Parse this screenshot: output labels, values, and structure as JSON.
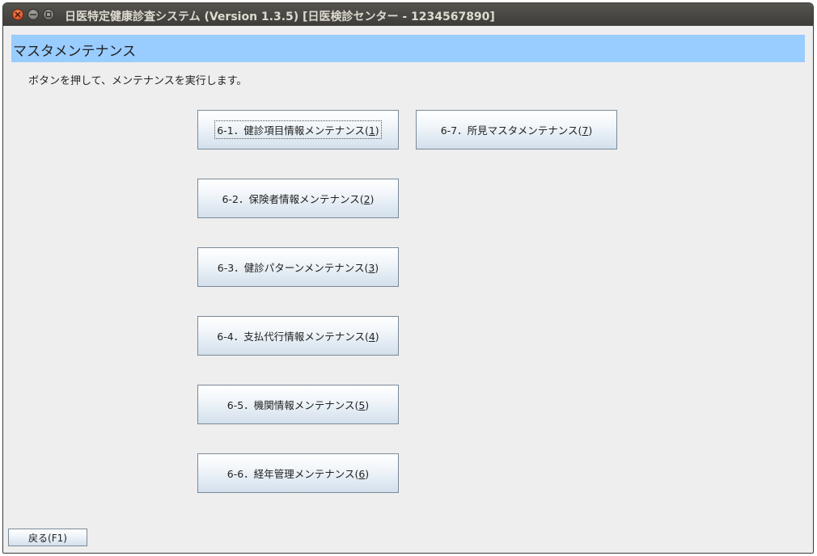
{
  "window": {
    "title": "日医特定健康診査システム (Version 1.3.5) [日医検診センター - 1234567890]"
  },
  "header": {
    "title": "マスタメンテナンス"
  },
  "instruction": "ボタンを押して、メンテナンスを実行します。",
  "buttons": [
    {
      "prefix": "6-1．健診項目情報メンテナンス(",
      "key": "1",
      "suffix": ")"
    },
    {
      "prefix": "6-2．保険者情報メンテナンス(",
      "key": "2",
      "suffix": ")"
    },
    {
      "prefix": "6-3．健診パターンメンテナンス(",
      "key": "3",
      "suffix": ")"
    },
    {
      "prefix": "6-4．支払代行情報メンテナンス(",
      "key": "4",
      "suffix": ")"
    },
    {
      "prefix": "6-5．機関情報メンテナンス(",
      "key": "5",
      "suffix": ")"
    },
    {
      "prefix": "6-6．経年管理メンテナンス(",
      "key": "6",
      "suffix": ")"
    },
    {
      "prefix": "6-7．所見マスタメンテナンス(",
      "key": "7",
      "suffix": ")"
    }
  ],
  "footer": {
    "back_label": "戻る(F1)"
  },
  "colors": {
    "header_band": "#99ccff",
    "titlebar": "#3d3c38",
    "close_button": "#d4441b"
  },
  "icons": {
    "close": "close-icon",
    "minimize": "minimize-icon",
    "maximize": "maximize-icon"
  }
}
